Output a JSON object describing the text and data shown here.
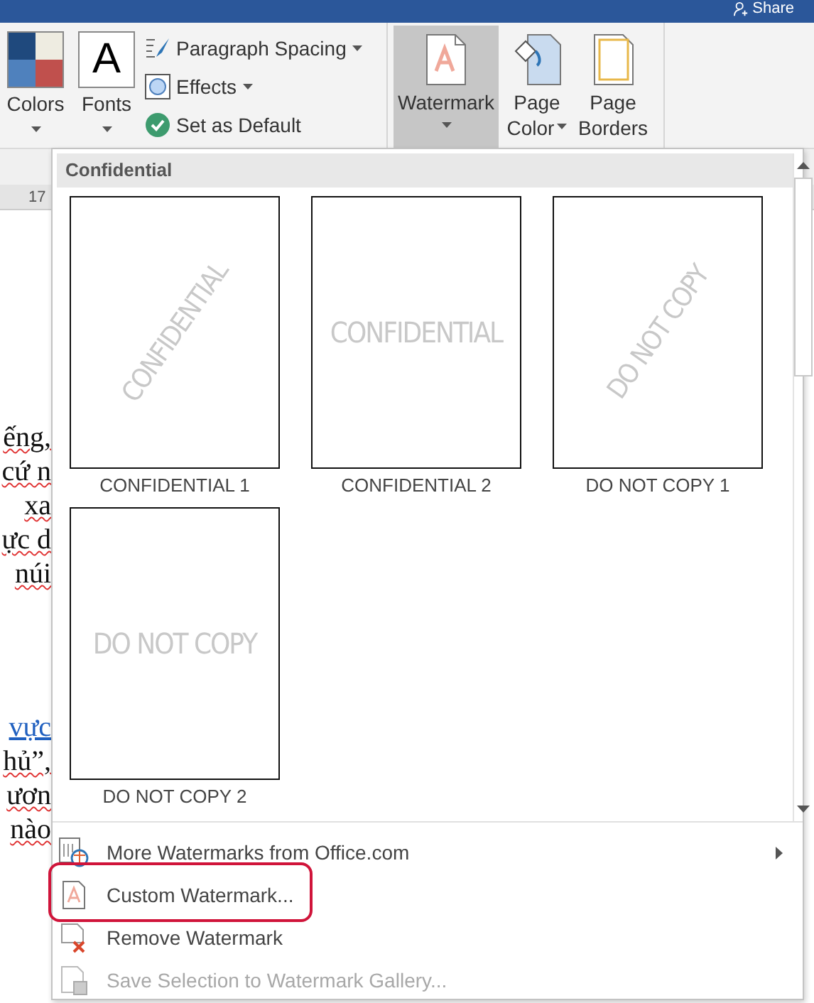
{
  "title_bar": {
    "share_label": "Share"
  },
  "ribbon": {
    "theme_buttons": [
      {
        "kind": "colors",
        "label": "Colors"
      },
      {
        "kind": "fonts",
        "label": "Fonts",
        "glyph": "A"
      }
    ],
    "theme_options": [
      {
        "kind": "spacing",
        "label": "Paragraph Spacing",
        "dropdown": true
      },
      {
        "kind": "effects",
        "label": "Effects",
        "dropdown": true
      },
      {
        "kind": "default",
        "label": "Set as Default",
        "dropdown": false
      }
    ],
    "page_buttons": [
      {
        "kind": "watermark",
        "lines": [
          "Watermark"
        ],
        "selected": true,
        "caret_below": true
      },
      {
        "kind": "color",
        "lines": [
          "Page",
          "Color"
        ],
        "selected": false,
        "caret_below": false
      },
      {
        "kind": "borders",
        "lines": [
          "Page",
          "Borders"
        ],
        "selected": false,
        "caret_below": false
      }
    ]
  },
  "ruler": {
    "mark": "17"
  },
  "document": {
    "paragraphs": [
      {
        "lines": [
          {
            "text": "ếng,",
            "link": false
          },
          {
            "text": "cứ n",
            "link": false
          },
          {
            "text": "xa",
            "link": false
          },
          {
            "text": "ực d",
            "link": false
          },
          {
            "text": "núi",
            "link": false
          }
        ]
      },
      {
        "lines": [
          {
            "text": "vực",
            "link": true
          },
          {
            "text": "hủ”,",
            "link": false
          },
          {
            "text": "ươn",
            "link": false
          },
          {
            "text": "nào",
            "link": false
          }
        ]
      }
    ]
  },
  "watermark_menu": {
    "section_title": "Confidential",
    "gallery": [
      {
        "name": "CONFIDENTIAL 1",
        "watermark": "CONFIDENTIAL",
        "kind": "diagonal"
      },
      {
        "name": "CONFIDENTIAL 2",
        "watermark": "CONFIDENTIAL",
        "kind": "horizontal"
      },
      {
        "name": "DO NOT COPY 1",
        "watermark": "DO NOT COPY",
        "kind": "diagonal"
      },
      {
        "name": "DO NOT COPY 2",
        "watermark": "DO NOT COPY",
        "kind": "horizontal"
      }
    ],
    "commands": [
      {
        "kind": "more",
        "label": "More Watermarks from Office.com",
        "submenu": true,
        "disabled": false,
        "highlighted": false
      },
      {
        "kind": "custom",
        "label": "Custom Watermark...",
        "submenu": false,
        "disabled": false,
        "highlighted": true
      },
      {
        "kind": "remove",
        "label": "Remove Watermark",
        "submenu": false,
        "disabled": false,
        "highlighted": false
      },
      {
        "kind": "save",
        "label": "Save Selection to Watermark Gallery...",
        "submenu": false,
        "disabled": true,
        "highlighted": false
      }
    ]
  }
}
